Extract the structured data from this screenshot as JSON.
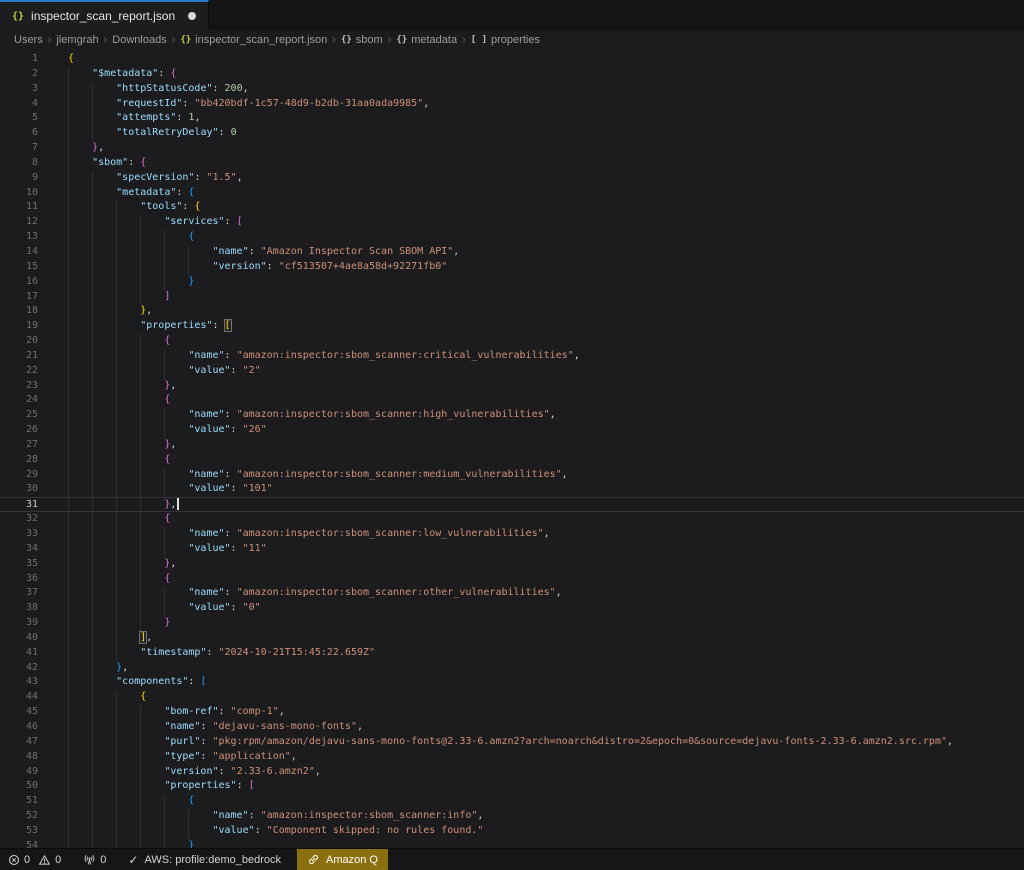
{
  "tab": {
    "title": "inspector_scan_report.json",
    "modified": true
  },
  "breadcrumb": {
    "items": [
      {
        "label": "Users"
      },
      {
        "label": "jlemgrah"
      },
      {
        "label": "Downloads"
      },
      {
        "label": "inspector_scan_report.json",
        "icon": "braces",
        "icon_color": "#cbcb41"
      },
      {
        "label": "sbom",
        "icon": "braces",
        "icon_color": "#c2c2c2"
      },
      {
        "label": "metadata",
        "icon": "braces",
        "icon_color": "#c2c2c2"
      },
      {
        "label": "properties",
        "icon": "brackets",
        "icon_color": "#c2c2c2"
      }
    ]
  },
  "editor": {
    "active_line": 31,
    "bracket_match_lines": [
      19,
      40
    ],
    "lines": [
      {
        "n": 1,
        "ind": 0,
        "tok": [
          [
            "b1",
            "{"
          ]
        ]
      },
      {
        "n": 2,
        "ind": 1,
        "tok": [
          [
            "k",
            "\"$metadata\""
          ],
          [
            "p",
            ": "
          ],
          [
            "b2",
            "{"
          ]
        ]
      },
      {
        "n": 3,
        "ind": 2,
        "tok": [
          [
            "k",
            "\"httpStatusCode\""
          ],
          [
            "p",
            ": "
          ],
          [
            "n",
            "200"
          ],
          [
            "p",
            ","
          ]
        ]
      },
      {
        "n": 4,
        "ind": 2,
        "tok": [
          [
            "k",
            "\"requestId\""
          ],
          [
            "p",
            ": "
          ],
          [
            "s",
            "\"bb420bdf-1c57-48d9-b2db-31aa0ada9985\""
          ],
          [
            "p",
            ","
          ]
        ]
      },
      {
        "n": 5,
        "ind": 2,
        "tok": [
          [
            "k",
            "\"attempts\""
          ],
          [
            "p",
            ": "
          ],
          [
            "n",
            "1"
          ],
          [
            "p",
            ","
          ]
        ]
      },
      {
        "n": 6,
        "ind": 2,
        "tok": [
          [
            "k",
            "\"totalRetryDelay\""
          ],
          [
            "p",
            ": "
          ],
          [
            "n",
            "0"
          ]
        ]
      },
      {
        "n": 7,
        "ind": 1,
        "tok": [
          [
            "b2",
            "}"
          ],
          [
            "p",
            ","
          ]
        ]
      },
      {
        "n": 8,
        "ind": 1,
        "tok": [
          [
            "k",
            "\"sbom\""
          ],
          [
            "p",
            ": "
          ],
          [
            "b2",
            "{"
          ]
        ]
      },
      {
        "n": 9,
        "ind": 2,
        "tok": [
          [
            "k",
            "\"specVersion\""
          ],
          [
            "p",
            ": "
          ],
          [
            "s",
            "\"1.5\""
          ],
          [
            "p",
            ","
          ]
        ]
      },
      {
        "n": 10,
        "ind": 2,
        "tok": [
          [
            "k",
            "\"metadata\""
          ],
          [
            "p",
            ": "
          ],
          [
            "b3",
            "{"
          ]
        ]
      },
      {
        "n": 11,
        "ind": 3,
        "tok": [
          [
            "k",
            "\"tools\""
          ],
          [
            "p",
            ": "
          ],
          [
            "b1",
            "{"
          ]
        ]
      },
      {
        "n": 12,
        "ind": 4,
        "tok": [
          [
            "k",
            "\"services\""
          ],
          [
            "p",
            ": "
          ],
          [
            "b2",
            "["
          ]
        ]
      },
      {
        "n": 13,
        "ind": 5,
        "tok": [
          [
            "b3",
            "{"
          ]
        ]
      },
      {
        "n": 14,
        "ind": 6,
        "tok": [
          [
            "k",
            "\"name\""
          ],
          [
            "p",
            ": "
          ],
          [
            "s",
            "\"Amazon Inspector Scan SBOM API\""
          ],
          [
            "p",
            ","
          ]
        ]
      },
      {
        "n": 15,
        "ind": 6,
        "tok": [
          [
            "k",
            "\"version\""
          ],
          [
            "p",
            ": "
          ],
          [
            "s",
            "\"cf513507+4ae8a58d+92271fb0\""
          ]
        ]
      },
      {
        "n": 16,
        "ind": 5,
        "tok": [
          [
            "b3",
            "}"
          ]
        ]
      },
      {
        "n": 17,
        "ind": 4,
        "tok": [
          [
            "b2",
            "]"
          ]
        ]
      },
      {
        "n": 18,
        "ind": 3,
        "tok": [
          [
            "b1",
            "}"
          ],
          [
            "p",
            ","
          ]
        ]
      },
      {
        "n": 19,
        "ind": 3,
        "tok": [
          [
            "k",
            "\"properties\""
          ],
          [
            "p",
            ": "
          ],
          [
            "bm",
            "["
          ]
        ]
      },
      {
        "n": 20,
        "ind": 4,
        "tok": [
          [
            "b2",
            "{"
          ]
        ]
      },
      {
        "n": 21,
        "ind": 5,
        "tok": [
          [
            "k",
            "\"name\""
          ],
          [
            "p",
            ": "
          ],
          [
            "s",
            "\"amazon:inspector:sbom_scanner:critical_vulnerabilities\""
          ],
          [
            "p",
            ","
          ]
        ]
      },
      {
        "n": 22,
        "ind": 5,
        "tok": [
          [
            "k",
            "\"value\""
          ],
          [
            "p",
            ": "
          ],
          [
            "s",
            "\"2\""
          ]
        ]
      },
      {
        "n": 23,
        "ind": 4,
        "tok": [
          [
            "b2",
            "}"
          ],
          [
            "p",
            ","
          ]
        ]
      },
      {
        "n": 24,
        "ind": 4,
        "tok": [
          [
            "b2",
            "{"
          ]
        ]
      },
      {
        "n": 25,
        "ind": 5,
        "tok": [
          [
            "k",
            "\"name\""
          ],
          [
            "p",
            ": "
          ],
          [
            "s",
            "\"amazon:inspector:sbom_scanner:high_vulnerabilities\""
          ],
          [
            "p",
            ","
          ]
        ]
      },
      {
        "n": 26,
        "ind": 5,
        "tok": [
          [
            "k",
            "\"value\""
          ],
          [
            "p",
            ": "
          ],
          [
            "s",
            "\"26\""
          ]
        ]
      },
      {
        "n": 27,
        "ind": 4,
        "tok": [
          [
            "b2",
            "}"
          ],
          [
            "p",
            ","
          ]
        ]
      },
      {
        "n": 28,
        "ind": 4,
        "tok": [
          [
            "b2",
            "{"
          ]
        ]
      },
      {
        "n": 29,
        "ind": 5,
        "tok": [
          [
            "k",
            "\"name\""
          ],
          [
            "p",
            ": "
          ],
          [
            "s",
            "\"amazon:inspector:sbom_scanner:medium_vulnerabilities\""
          ],
          [
            "p",
            ","
          ]
        ]
      },
      {
        "n": 30,
        "ind": 5,
        "tok": [
          [
            "k",
            "\"value\""
          ],
          [
            "p",
            ": "
          ],
          [
            "s",
            "\"101\""
          ]
        ]
      },
      {
        "n": 31,
        "ind": 4,
        "tok": [
          [
            "b2",
            "}"
          ],
          [
            "p",
            ","
          ]
        ],
        "cur": true
      },
      {
        "n": 32,
        "ind": 4,
        "tok": [
          [
            "b2",
            "{"
          ]
        ]
      },
      {
        "n": 33,
        "ind": 5,
        "tok": [
          [
            "k",
            "\"name\""
          ],
          [
            "p",
            ": "
          ],
          [
            "s",
            "\"amazon:inspector:sbom_scanner:low_vulnerabilities\""
          ],
          [
            "p",
            ","
          ]
        ]
      },
      {
        "n": 34,
        "ind": 5,
        "tok": [
          [
            "k",
            "\"value\""
          ],
          [
            "p",
            ": "
          ],
          [
            "s",
            "\"11\""
          ]
        ]
      },
      {
        "n": 35,
        "ind": 4,
        "tok": [
          [
            "b2",
            "}"
          ],
          [
            "p",
            ","
          ]
        ]
      },
      {
        "n": 36,
        "ind": 4,
        "tok": [
          [
            "b2",
            "{"
          ]
        ]
      },
      {
        "n": 37,
        "ind": 5,
        "tok": [
          [
            "k",
            "\"name\""
          ],
          [
            "p",
            ": "
          ],
          [
            "s",
            "\"amazon:inspector:sbom_scanner:other_vulnerabilities\""
          ],
          [
            "p",
            ","
          ]
        ]
      },
      {
        "n": 38,
        "ind": 5,
        "tok": [
          [
            "k",
            "\"value\""
          ],
          [
            "p",
            ": "
          ],
          [
            "s",
            "\"0\""
          ]
        ]
      },
      {
        "n": 39,
        "ind": 4,
        "tok": [
          [
            "b2",
            "}"
          ]
        ]
      },
      {
        "n": 40,
        "ind": 3,
        "tok": [
          [
            "bm",
            "]"
          ],
          [
            "p",
            ","
          ]
        ]
      },
      {
        "n": 41,
        "ind": 3,
        "tok": [
          [
            "k",
            "\"timestamp\""
          ],
          [
            "p",
            ": "
          ],
          [
            "s",
            "\"2024-10-21T15:45:22.659Z\""
          ]
        ]
      },
      {
        "n": 42,
        "ind": 2,
        "tok": [
          [
            "b3",
            "}"
          ],
          [
            "p",
            ","
          ]
        ]
      },
      {
        "n": 43,
        "ind": 2,
        "tok": [
          [
            "k",
            "\"components\""
          ],
          [
            "p",
            ": "
          ],
          [
            "b3",
            "["
          ]
        ]
      },
      {
        "n": 44,
        "ind": 3,
        "tok": [
          [
            "b1",
            "{"
          ]
        ]
      },
      {
        "n": 45,
        "ind": 4,
        "tok": [
          [
            "k",
            "\"bom-ref\""
          ],
          [
            "p",
            ": "
          ],
          [
            "s",
            "\"comp-1\""
          ],
          [
            "p",
            ","
          ]
        ]
      },
      {
        "n": 46,
        "ind": 4,
        "tok": [
          [
            "k",
            "\"name\""
          ],
          [
            "p",
            ": "
          ],
          [
            "s",
            "\"dejavu-sans-mono-fonts\""
          ],
          [
            "p",
            ","
          ]
        ]
      },
      {
        "n": 47,
        "ind": 4,
        "tok": [
          [
            "k",
            "\"purl\""
          ],
          [
            "p",
            ": "
          ],
          [
            "s",
            "\"pkg:rpm/amazon/dejavu-sans-mono-fonts@2.33-6.amzn2?arch=noarch&distro=2&epoch=0&source=dejavu-fonts-2.33-6.amzn2.src.rpm\""
          ],
          [
            "p",
            ","
          ]
        ]
      },
      {
        "n": 48,
        "ind": 4,
        "tok": [
          [
            "k",
            "\"type\""
          ],
          [
            "p",
            ": "
          ],
          [
            "s",
            "\"application\""
          ],
          [
            "p",
            ","
          ]
        ]
      },
      {
        "n": 49,
        "ind": 4,
        "tok": [
          [
            "k",
            "\"version\""
          ],
          [
            "p",
            ": "
          ],
          [
            "s",
            "\"2.33-6.amzn2\""
          ],
          [
            "p",
            ","
          ]
        ]
      },
      {
        "n": 50,
        "ind": 4,
        "tok": [
          [
            "k",
            "\"properties\""
          ],
          [
            "p",
            ": "
          ],
          [
            "b2",
            "["
          ]
        ]
      },
      {
        "n": 51,
        "ind": 5,
        "tok": [
          [
            "b3",
            "{"
          ]
        ]
      },
      {
        "n": 52,
        "ind": 6,
        "tok": [
          [
            "k",
            "\"name\""
          ],
          [
            "p",
            ": "
          ],
          [
            "s",
            "\"amazon:inspector:sbom_scanner:info\""
          ],
          [
            "p",
            ","
          ]
        ]
      },
      {
        "n": 53,
        "ind": 6,
        "tok": [
          [
            "k",
            "\"value\""
          ],
          [
            "p",
            ": "
          ],
          [
            "s",
            "\"Component skipped: no rules found.\""
          ]
        ]
      },
      {
        "n": 54,
        "ind": 5,
        "tok": [
          [
            "b3",
            "}"
          ]
        ]
      }
    ]
  },
  "status": {
    "errors": "0",
    "warnings": "0",
    "ports": "0",
    "aws_label": "AWS: profile:demo_bedrock",
    "amazon_q_label": "Amazon Q"
  },
  "colors": {
    "accent_blue": "#2577c8",
    "badge_gold": "#8c700f",
    "json_icon_yellow": "#cbcb41",
    "key": "#9cdcfe",
    "string": "#ce9178",
    "number": "#b5cea8",
    "bracket_level_1": "#ffd700",
    "bracket_level_2": "#da70d6",
    "bracket_level_3": "#179fff",
    "editor_background": "#1c1c1e"
  }
}
